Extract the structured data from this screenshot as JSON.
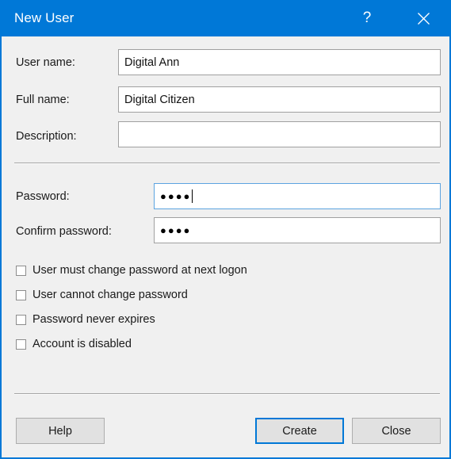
{
  "window": {
    "title": "New User",
    "accent_color": "#0078d7",
    "background_color": "#f0f0f0",
    "help_icon": "question-mark-icon",
    "close_icon": "close-x-icon",
    "help_glyph": "?"
  },
  "form": {
    "fields": [
      {
        "label": "User name:",
        "value": "Digital Ann",
        "placeholder": ""
      },
      {
        "label": "Full name:",
        "value": "Digital Citizen",
        "placeholder": ""
      },
      {
        "label": "Description:",
        "value": "",
        "placeholder": ""
      }
    ],
    "password_fields": [
      {
        "label": "Password:",
        "value": "●●●●",
        "focused": true
      },
      {
        "label": "Confirm password:",
        "value": "●●●●",
        "focused": false
      }
    ],
    "checkboxes": [
      {
        "label": "User must change password at next logon",
        "checked": false
      },
      {
        "label": "User cannot change password",
        "checked": false
      },
      {
        "label": "Password never expires",
        "checked": false
      },
      {
        "label": "Account is disabled",
        "checked": false
      }
    ]
  },
  "buttons": {
    "help": "Help",
    "create": "Create",
    "close": "Close"
  }
}
